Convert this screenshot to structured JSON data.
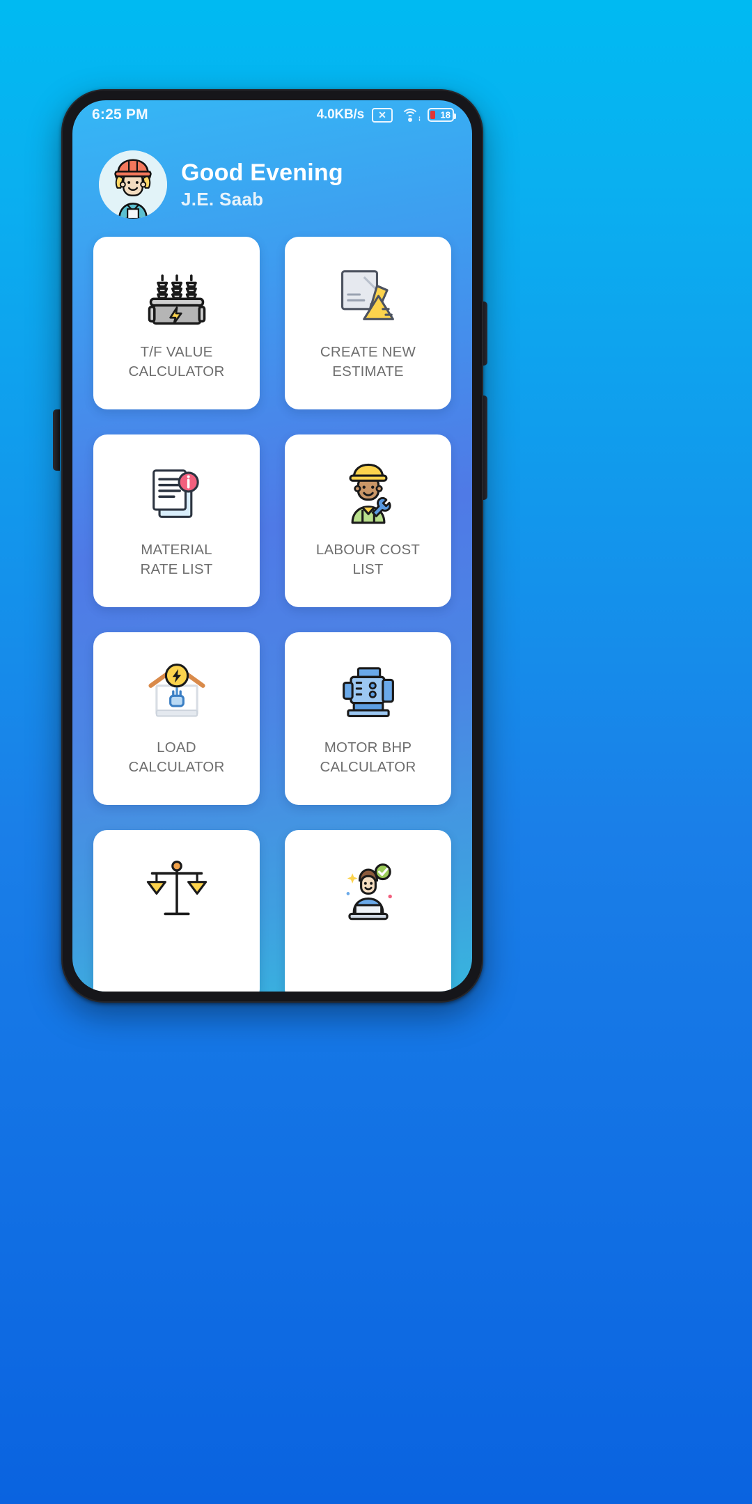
{
  "status_bar": {
    "time": "6:25 PM",
    "network_speed": "4.0KB/s",
    "sim_icon": "sim-card-disabled-icon",
    "sim_glyph": "✕",
    "wifi_icon": "wifi-icon",
    "battery_icon": "battery-icon",
    "battery_level": "18"
  },
  "header": {
    "avatar_icon": "engineer-avatar",
    "greeting": "Good Evening",
    "user_name": "J.E. Saab"
  },
  "colors": {
    "page_background_top": "#00baf2",
    "page_background_bottom": "#0a63e0",
    "screen_gradient_start": "#35b7f5",
    "screen_gradient_mid": "#4f7ae6",
    "screen_gradient_end": "#37b5de",
    "card_background": "#ffffff",
    "card_label": "#6e6e6e",
    "battery_fill": "#e03636"
  },
  "grid": {
    "cards": [
      {
        "label": "T/F VALUE\nCALCULATOR",
        "icon": "transformer-icon"
      },
      {
        "label": "CREATE NEW\nESTIMATE",
        "icon": "blueprint-pencil-icon"
      },
      {
        "label": "MATERIAL\nRATE LIST",
        "icon": "document-info-icon"
      },
      {
        "label": "LABOUR COST\nLIST",
        "icon": "worker-wrench-icon"
      },
      {
        "label": "LOAD\nCALCULATOR",
        "icon": "house-power-icon"
      },
      {
        "label": "MOTOR BHP\nCALCULATOR",
        "icon": "electric-motor-icon"
      },
      {
        "label": "",
        "icon": "balance-scale-icon"
      },
      {
        "label": "",
        "icon": "person-laptop-check-icon"
      }
    ]
  }
}
